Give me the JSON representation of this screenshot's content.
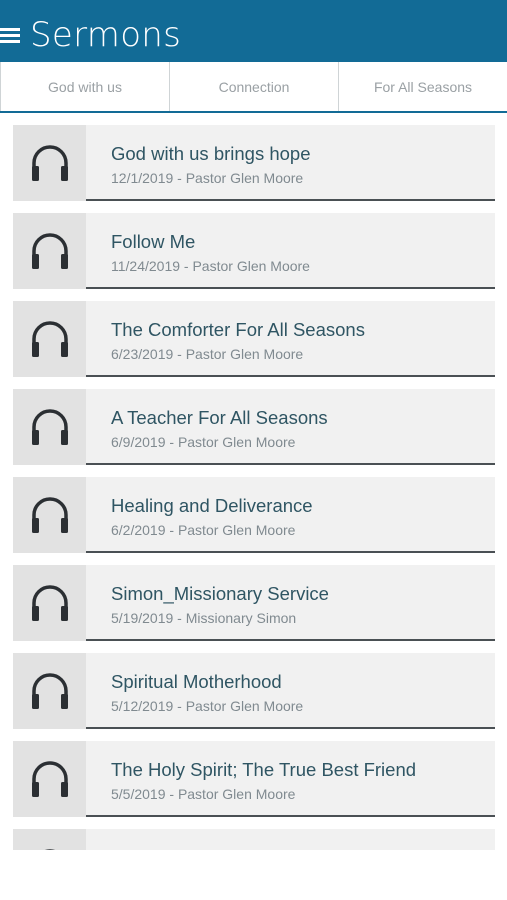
{
  "header": {
    "title": "Sermons"
  },
  "tabs": [
    "God with us",
    "Connection",
    "For All Seasons"
  ],
  "sermons": [
    {
      "title": "God with us brings hope",
      "subtitle": "12/1/2019 - Pastor Glen Moore"
    },
    {
      "title": "Follow Me",
      "subtitle": "11/24/2019 - Pastor Glen Moore"
    },
    {
      "title": "The Comforter For All Seasons",
      "subtitle": "6/23/2019 - Pastor Glen Moore"
    },
    {
      "title": "A Teacher For All Seasons",
      "subtitle": "6/9/2019 - Pastor Glen Moore"
    },
    {
      "title": "Healing and Deliverance",
      "subtitle": "6/2/2019 - Pastor Glen Moore"
    },
    {
      "title": "Simon_Missionary Service",
      "subtitle": "5/19/2019 - Missionary Simon"
    },
    {
      "title": "Spiritual Motherhood",
      "subtitle": "5/12/2019 - Pastor Glen Moore"
    },
    {
      "title": "The Holy Spirit; The True Best Friend",
      "subtitle": "5/5/2019 - Pastor Glen Moore"
    }
  ],
  "colors": {
    "header": "#126b96",
    "row_bg": "#f1f1f1",
    "icon_bg": "#e2e2e2"
  },
  "icons": {
    "menu": "hamburger-menu-icon",
    "row": "headphones-icon"
  }
}
